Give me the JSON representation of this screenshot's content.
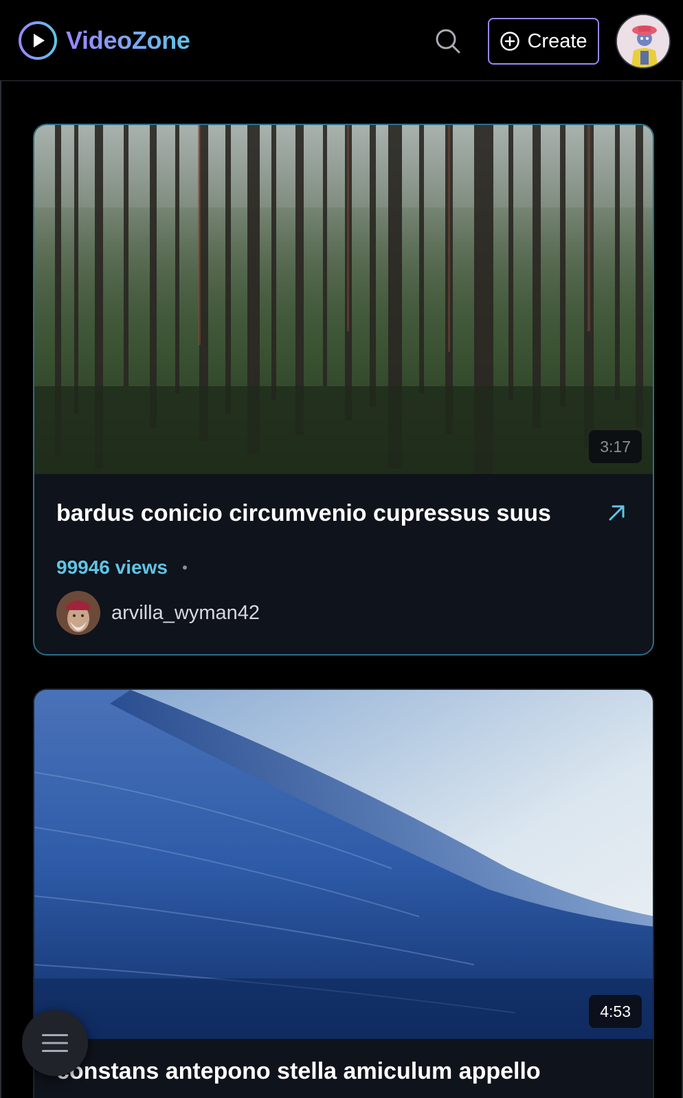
{
  "app": {
    "name": "VideoZone",
    "accent_purple": "#9a86ff",
    "accent_cyan": "#5fc4e6"
  },
  "header": {
    "logo_icon": "play-circle-icon",
    "search_icon": "search-icon",
    "create_label": "Create",
    "create_icon": "plus-circle-icon",
    "avatar_icon": "user-avatar"
  },
  "videos": [
    {
      "title": "bardus conicio circumvenio cupressus suus",
      "duration": "3:17",
      "views": "99946 views",
      "author": "arvilla_wyman42",
      "thumbnail": "forest"
    },
    {
      "title": "constans antepono stella amiculum appello",
      "duration": "4:53",
      "thumbnail": "ocean-wave"
    }
  ],
  "fab": {
    "icon": "menu-icon"
  }
}
